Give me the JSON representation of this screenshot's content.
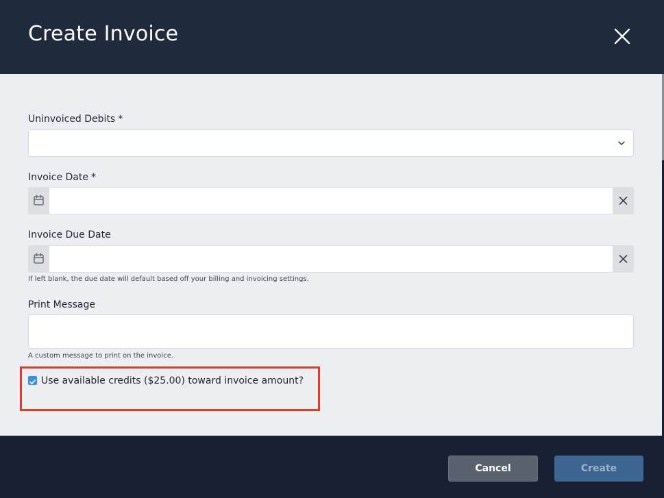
{
  "dialog": {
    "title": "Create Invoice"
  },
  "fields": {
    "uninvoiced_debits": {
      "label": "Uninvoiced Debits",
      "required_mark": "*",
      "value": ""
    },
    "invoice_date": {
      "label": "Invoice Date",
      "required_mark": "*",
      "value": ""
    },
    "invoice_due_date": {
      "label": "Invoice Due Date",
      "value": "",
      "hint": "If left blank, the due date will default based off your billing and invoicing settings."
    },
    "print_message": {
      "label": "Print Message",
      "value": "",
      "hint": "A custom message to print on the invoice."
    },
    "use_credits": {
      "label": "Use available credits ($25.00) toward invoice amount?",
      "checked": true
    }
  },
  "footer": {
    "cancel_label": "Cancel",
    "create_label": "Create"
  },
  "icons": {
    "close": "close-icon",
    "chevron": "chevron-down-icon",
    "calendar": "calendar-icon",
    "clear": "clear-icon",
    "check": "checkmark-icon"
  },
  "colors": {
    "header_bg": "#1f2b3c",
    "body_bg": "#edeef2",
    "footer_bg": "#162032",
    "highlight": "#e03a2c",
    "checkbox": "#3a8ee6",
    "cancel_bg": "#5a6270",
    "create_bg": "#3d6591"
  }
}
